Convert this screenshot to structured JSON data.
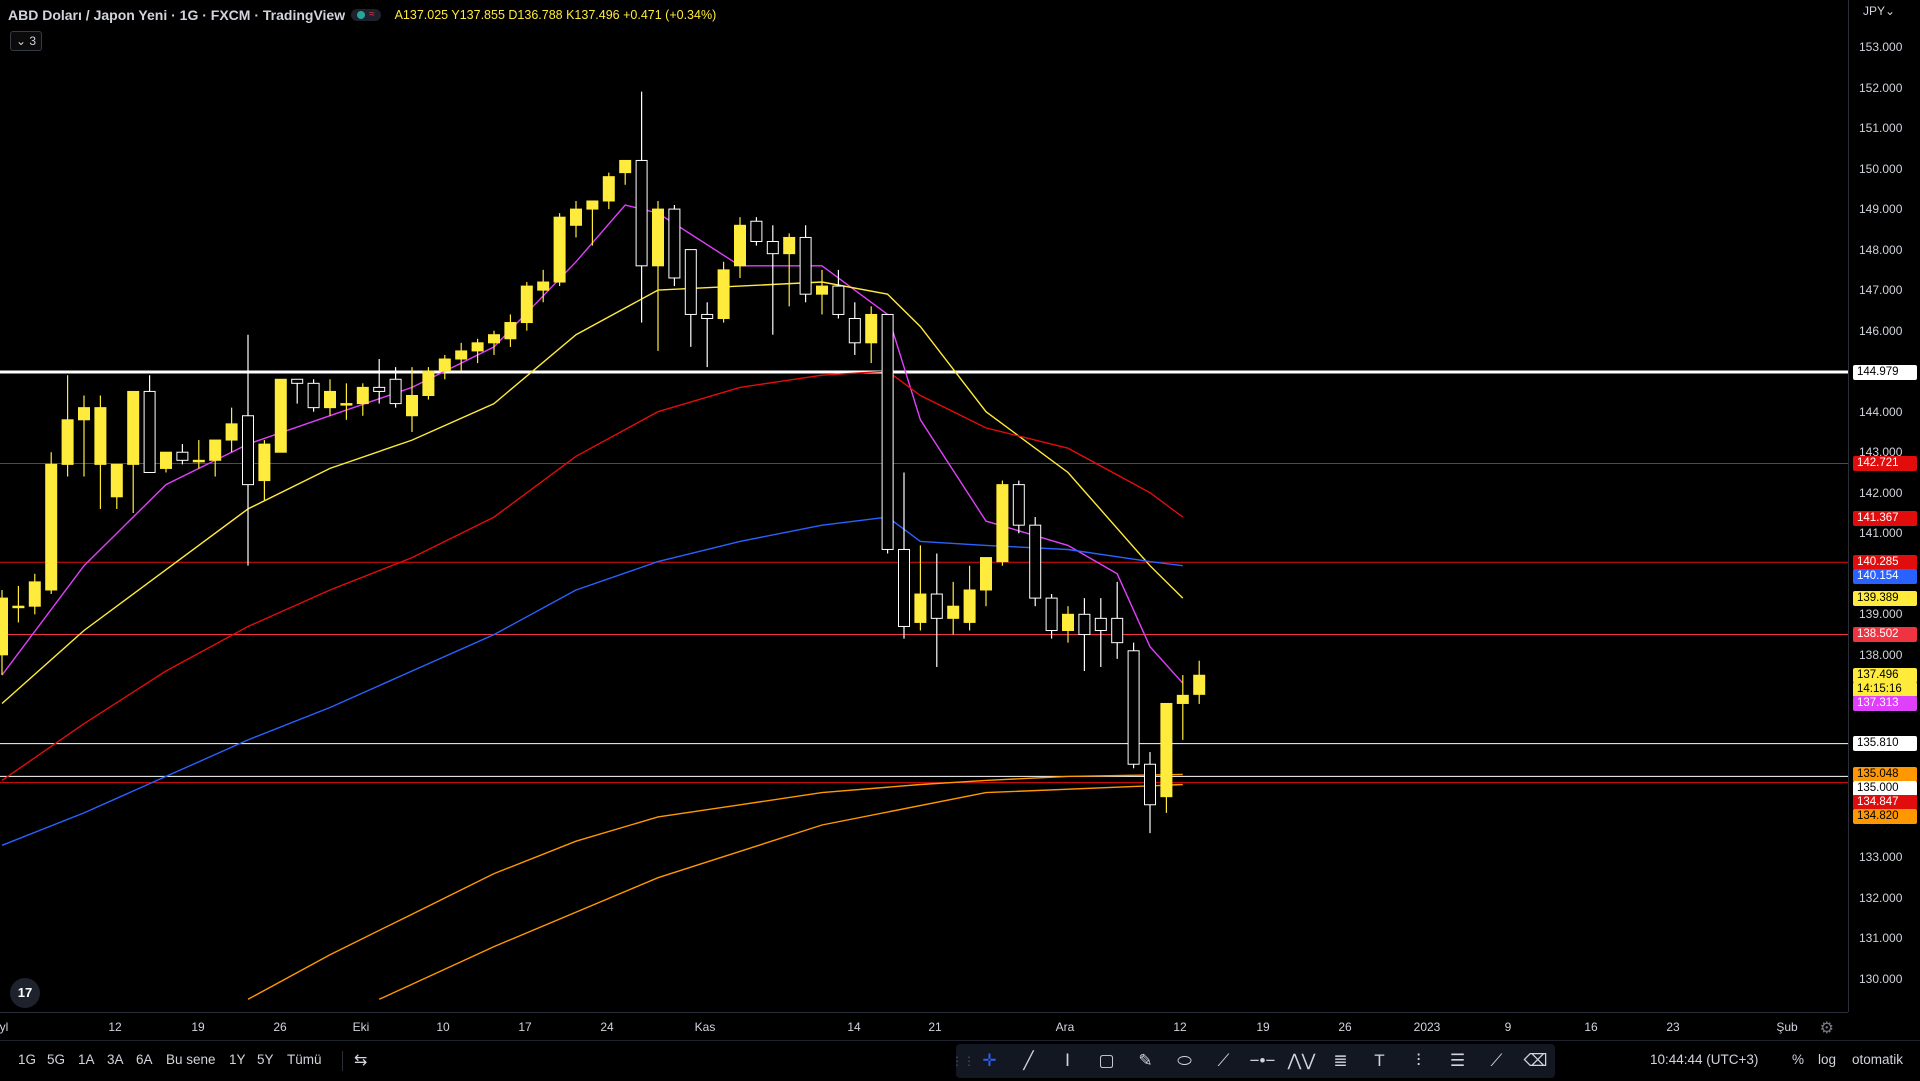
{
  "legend": {
    "title": "ABD Doları / Japon Yeni · 1G · FXCM · TradingView",
    "open": "A137.025",
    "high": "Y137.855",
    "low": "D136.788",
    "close": "K137.496",
    "change": "+0.471 (+0.34%)",
    "indicator_count": "⌄ 3"
  },
  "price_axis": {
    "currency": "JPY⌄",
    "ticks": [
      "153.000",
      "152.000",
      "151.000",
      "150.000",
      "149.000",
      "148.000",
      "147.000",
      "146.000",
      "144.000",
      "143.000",
      "142.000",
      "141.000",
      "139.000",
      "138.000",
      "133.000",
      "132.000",
      "131.000",
      "130.000"
    ],
    "labels": [
      {
        "text": "144.979",
        "bg": "#ffffff",
        "fg": "#000000"
      },
      {
        "text": "142.721",
        "bg": "#e10d0d",
        "fg": "#ffffff"
      },
      {
        "text": "141.367",
        "bg": "#e10d0d",
        "fg": "#ffffff"
      },
      {
        "text": "140.285",
        "bg": "#e10d0d",
        "fg": "#ffffff"
      },
      {
        "text": "140.154",
        "bg": "#2962ff",
        "fg": "#ffffff"
      },
      {
        "text": "139.389",
        "bg": "#ffeb3b",
        "fg": "#000000"
      },
      {
        "text": "138.502",
        "bg": "#ef3340",
        "fg": "#ffffff"
      },
      {
        "text": "137.496",
        "bg": "#ffeb3b",
        "fg": "#000000"
      },
      {
        "text": "14:15:16",
        "bg": "#ffeb3b",
        "fg": "#000000"
      },
      {
        "text": "137.313",
        "bg": "#e040fb",
        "fg": "#ffffff"
      },
      {
        "text": "135.810",
        "bg": "#ffffff",
        "fg": "#000000"
      },
      {
        "text": "135.048",
        "bg": "#ff9800",
        "fg": "#000000"
      },
      {
        "text": "135.000",
        "bg": "#ffffff",
        "fg": "#000000"
      },
      {
        "text": "134.847",
        "bg": "#e10d0d",
        "fg": "#ffffff"
      },
      {
        "text": "134.820",
        "bg": "#ff9800",
        "fg": "#000000"
      }
    ]
  },
  "time_axis": {
    "ticks": [
      "yl",
      "12",
      "19",
      "26",
      "Eki",
      "10",
      "17",
      "24",
      "Kas",
      "14",
      "21",
      "Ara",
      "12",
      "19",
      "26",
      "2023",
      "9",
      "16",
      "23",
      "Şub"
    ]
  },
  "bottom_bar": {
    "ranges": [
      "1G",
      "5G",
      "1A",
      "3A",
      "6A",
      "Bu sene",
      "1Y",
      "5Y",
      "Tümü"
    ],
    "clock": "10:44:44 (UTC+3)",
    "percent": "%",
    "log": "log",
    "auto": "otomatik"
  },
  "chart_data": {
    "type": "candlestick",
    "symbol": "USDJPY",
    "ylim": [
      129.5,
      153.9
    ],
    "yscale": "linear",
    "grid": false,
    "candles": [
      {
        "o": 138.0,
        "h": 139.6,
        "l": 137.5,
        "c": 139.4
      },
      {
        "o": 139.2,
        "h": 139.7,
        "l": 138.8,
        "c": 139.2
      },
      {
        "o": 139.2,
        "h": 140.0,
        "l": 139.0,
        "c": 139.8
      },
      {
        "o": 139.6,
        "h": 143.0,
        "l": 139.5,
        "c": 142.7
      },
      {
        "o": 142.7,
        "h": 144.9,
        "l": 142.4,
        "c": 143.8
      },
      {
        "o": 143.8,
        "h": 144.4,
        "l": 142.4,
        "c": 144.1
      },
      {
        "o": 142.7,
        "h": 144.4,
        "l": 141.6,
        "c": 144.1
      },
      {
        "o": 141.9,
        "h": 142.7,
        "l": 141.6,
        "c": 142.7
      },
      {
        "o": 142.7,
        "h": 144.4,
        "l": 141.5,
        "c": 144.5
      },
      {
        "o": 144.5,
        "h": 144.9,
        "l": 142.5,
        "c": 142.5
      },
      {
        "o": 142.6,
        "h": 143.0,
        "l": 142.5,
        "c": 143.0
      },
      {
        "o": 143.0,
        "h": 143.2,
        "l": 142.7,
        "c": 142.8
      },
      {
        "o": 142.8,
        "h": 143.3,
        "l": 142.6,
        "c": 142.8
      },
      {
        "o": 142.8,
        "h": 143.3,
        "l": 142.4,
        "c": 143.3
      },
      {
        "o": 143.3,
        "h": 144.1,
        "l": 143.0,
        "c": 143.7
      },
      {
        "o": 143.9,
        "h": 145.9,
        "l": 140.2,
        "c": 142.2
      },
      {
        "o": 142.3,
        "h": 143.3,
        "l": 141.8,
        "c": 143.2
      },
      {
        "o": 143.0,
        "h": 144.8,
        "l": 143.0,
        "c": 144.8
      },
      {
        "o": 144.8,
        "h": 144.8,
        "l": 144.2,
        "c": 144.7
      },
      {
        "o": 144.7,
        "h": 144.8,
        "l": 144.0,
        "c": 144.1
      },
      {
        "o": 144.1,
        "h": 144.8,
        "l": 143.9,
        "c": 144.5
      },
      {
        "o": 144.2,
        "h": 144.7,
        "l": 143.8,
        "c": 144.2
      },
      {
        "o": 144.2,
        "h": 144.7,
        "l": 143.9,
        "c": 144.6
      },
      {
        "o": 144.6,
        "h": 145.3,
        "l": 144.2,
        "c": 144.5
      },
      {
        "o": 144.8,
        "h": 145.1,
        "l": 144.1,
        "c": 144.2
      },
      {
        "o": 143.9,
        "h": 145.1,
        "l": 143.5,
        "c": 144.4
      },
      {
        "o": 144.4,
        "h": 145.1,
        "l": 144.3,
        "c": 145.0
      },
      {
        "o": 145.0,
        "h": 145.4,
        "l": 144.8,
        "c": 145.3
      },
      {
        "o": 145.3,
        "h": 145.7,
        "l": 145.0,
        "c": 145.5
      },
      {
        "o": 145.5,
        "h": 145.8,
        "l": 145.2,
        "c": 145.7
      },
      {
        "o": 145.7,
        "h": 146.0,
        "l": 145.4,
        "c": 145.9
      },
      {
        "o": 145.8,
        "h": 146.4,
        "l": 145.6,
        "c": 146.2
      },
      {
        "o": 146.2,
        "h": 147.2,
        "l": 146.0,
        "c": 147.1
      },
      {
        "o": 147.0,
        "h": 147.5,
        "l": 146.7,
        "c": 147.2
      },
      {
        "o": 147.2,
        "h": 148.9,
        "l": 147.1,
        "c": 148.8
      },
      {
        "o": 148.6,
        "h": 149.2,
        "l": 148.3,
        "c": 149.0
      },
      {
        "o": 149.0,
        "h": 149.2,
        "l": 148.1,
        "c": 149.2
      },
      {
        "o": 149.2,
        "h": 149.9,
        "l": 149.0,
        "c": 149.8
      },
      {
        "o": 149.9,
        "h": 150.2,
        "l": 149.6,
        "c": 150.2
      },
      {
        "o": 150.2,
        "h": 151.9,
        "l": 146.2,
        "c": 147.6
      },
      {
        "o": 147.6,
        "h": 149.2,
        "l": 145.5,
        "c": 149.0
      },
      {
        "o": 149.0,
        "h": 149.1,
        "l": 147.1,
        "c": 147.3
      },
      {
        "o": 148.0,
        "h": 148.0,
        "l": 145.6,
        "c": 146.4
      },
      {
        "o": 146.4,
        "h": 146.7,
        "l": 145.1,
        "c": 146.3
      },
      {
        "o": 146.3,
        "h": 147.7,
        "l": 146.2,
        "c": 147.5
      },
      {
        "o": 147.6,
        "h": 148.8,
        "l": 147.3,
        "c": 148.6
      },
      {
        "o": 148.7,
        "h": 148.8,
        "l": 148.1,
        "c": 148.2
      },
      {
        "o": 148.2,
        "h": 148.6,
        "l": 145.9,
        "c": 147.9
      },
      {
        "o": 147.9,
        "h": 148.4,
        "l": 146.6,
        "c": 148.3
      },
      {
        "o": 148.3,
        "h": 148.6,
        "l": 146.7,
        "c": 146.9
      },
      {
        "o": 146.9,
        "h": 147.5,
        "l": 146.4,
        "c": 147.1
      },
      {
        "o": 147.1,
        "h": 147.5,
        "l": 146.3,
        "c": 146.4
      },
      {
        "o": 146.3,
        "h": 146.7,
        "l": 145.4,
        "c": 145.7
      },
      {
        "o": 145.7,
        "h": 146.6,
        "l": 145.2,
        "c": 146.4
      },
      {
        "o": 146.4,
        "h": 146.4,
        "l": 140.5,
        "c": 140.6
      },
      {
        "o": 140.6,
        "h": 142.5,
        "l": 138.4,
        "c": 138.7
      },
      {
        "o": 138.8,
        "h": 140.7,
        "l": 138.6,
        "c": 139.5
      },
      {
        "o": 139.5,
        "h": 140.5,
        "l": 137.7,
        "c": 138.9
      },
      {
        "o": 138.9,
        "h": 139.8,
        "l": 138.5,
        "c": 139.2
      },
      {
        "o": 138.8,
        "h": 140.2,
        "l": 138.6,
        "c": 139.6
      },
      {
        "o": 139.6,
        "h": 140.3,
        "l": 139.2,
        "c": 140.4
      },
      {
        "o": 140.3,
        "h": 142.3,
        "l": 140.2,
        "c": 142.2
      },
      {
        "o": 142.2,
        "h": 142.3,
        "l": 141.0,
        "c": 141.2
      },
      {
        "o": 141.2,
        "h": 141.4,
        "l": 139.2,
        "c": 139.4
      },
      {
        "o": 139.4,
        "h": 139.5,
        "l": 138.4,
        "c": 138.6
      },
      {
        "o": 138.6,
        "h": 139.2,
        "l": 138.3,
        "c": 139.0
      },
      {
        "o": 139.0,
        "h": 139.4,
        "l": 137.6,
        "c": 138.5
      },
      {
        "o": 138.9,
        "h": 139.4,
        "l": 137.7,
        "c": 138.6
      },
      {
        "o": 138.9,
        "h": 139.8,
        "l": 137.9,
        "c": 138.3
      },
      {
        "o": 138.1,
        "h": 138.3,
        "l": 135.2,
        "c": 135.3
      },
      {
        "o": 135.3,
        "h": 135.6,
        "l": 133.6,
        "c": 134.3
      },
      {
        "o": 134.5,
        "h": 136.8,
        "l": 134.1,
        "c": 136.8
      },
      {
        "o": 136.8,
        "h": 137.5,
        "l": 135.9,
        "c": 137.0
      },
      {
        "o": 137.025,
        "h": 137.855,
        "l": 136.788,
        "c": 137.496
      }
    ],
    "horizontal_lines": [
      {
        "price": 144.979,
        "color": "#ffffff",
        "width": 3
      },
      {
        "price": 142.721,
        "color": "#e10d0d",
        "width": 1
      },
      {
        "price": 140.285,
        "color": "#e10d0d",
        "width": 1
      },
      {
        "price": 138.502,
        "color": "#ef3340",
        "width": 1
      },
      {
        "price": 135.81,
        "color": "#ffffff",
        "width": 1
      },
      {
        "price": 135.0,
        "color": "#ffffff",
        "width": 1
      },
      {
        "price": 134.847,
        "color": "#e10d0d",
        "width": 1
      }
    ],
    "moving_averages": [
      {
        "color": "#e040fb",
        "points": [
          [
            0,
            137.5
          ],
          [
            5,
            140.2
          ],
          [
            10,
            142.2
          ],
          [
            15,
            143.2
          ],
          [
            20,
            143.9
          ],
          [
            25,
            144.6
          ],
          [
            30,
            145.6
          ],
          [
            35,
            147.7
          ],
          [
            38,
            149.1
          ],
          [
            40,
            148.9
          ],
          [
            45,
            147.6
          ],
          [
            50,
            147.6
          ],
          [
            54,
            146.4
          ],
          [
            56,
            143.8
          ],
          [
            60,
            141.3
          ],
          [
            65,
            140.7
          ],
          [
            68,
            140.0
          ],
          [
            70,
            138.2
          ],
          [
            72,
            137.3
          ]
        ]
      },
      {
        "color": "#ffeb3b",
        "points": [
          [
            0,
            136.8
          ],
          [
            5,
            138.6
          ],
          [
            10,
            140.1
          ],
          [
            15,
            141.6
          ],
          [
            20,
            142.6
          ],
          [
            25,
            143.3
          ],
          [
            30,
            144.2
          ],
          [
            35,
            145.9
          ],
          [
            40,
            147.0
          ],
          [
            45,
            147.1
          ],
          [
            50,
            147.2
          ],
          [
            54,
            146.9
          ],
          [
            56,
            146.1
          ],
          [
            60,
            144.0
          ],
          [
            65,
            142.5
          ],
          [
            70,
            140.2
          ],
          [
            72,
            139.4
          ]
        ]
      },
      {
        "color": "#e10d0d",
        "points": [
          [
            0,
            134.9
          ],
          [
            5,
            136.3
          ],
          [
            10,
            137.6
          ],
          [
            15,
            138.7
          ],
          [
            20,
            139.6
          ],
          [
            25,
            140.4
          ],
          [
            30,
            141.4
          ],
          [
            35,
            142.9
          ],
          [
            40,
            144.0
          ],
          [
            45,
            144.6
          ],
          [
            50,
            144.9
          ],
          [
            54,
            145.0
          ],
          [
            56,
            144.4
          ],
          [
            60,
            143.6
          ],
          [
            65,
            143.1
          ],
          [
            70,
            142.0
          ],
          [
            72,
            141.4
          ]
        ]
      },
      {
        "color": "#2962ff",
        "points": [
          [
            0,
            133.3
          ],
          [
            5,
            134.1
          ],
          [
            10,
            135.0
          ],
          [
            15,
            135.9
          ],
          [
            20,
            136.7
          ],
          [
            25,
            137.6
          ],
          [
            30,
            138.5
          ],
          [
            35,
            139.6
          ],
          [
            40,
            140.3
          ],
          [
            45,
            140.8
          ],
          [
            50,
            141.2
          ],
          [
            54,
            141.4
          ],
          [
            56,
            140.8
          ],
          [
            60,
            140.7
          ],
          [
            65,
            140.6
          ],
          [
            70,
            140.3
          ],
          [
            72,
            140.2
          ]
        ]
      },
      {
        "color": "#ff9800",
        "points": [
          [
            15,
            129.5
          ],
          [
            20,
            130.6
          ],
          [
            25,
            131.6
          ],
          [
            30,
            132.6
          ],
          [
            35,
            133.4
          ],
          [
            40,
            134.0
          ],
          [
            45,
            134.3
          ],
          [
            50,
            134.6
          ],
          [
            56,
            134.8
          ],
          [
            60,
            134.9
          ],
          [
            65,
            135.0
          ],
          [
            72,
            135.05
          ]
        ]
      },
      {
        "color": "#ff9800",
        "points": [
          [
            23,
            129.5
          ],
          [
            30,
            130.8
          ],
          [
            40,
            132.5
          ],
          [
            50,
            133.8
          ],
          [
            60,
            134.6
          ],
          [
            72,
            134.8
          ]
        ]
      }
    ]
  }
}
